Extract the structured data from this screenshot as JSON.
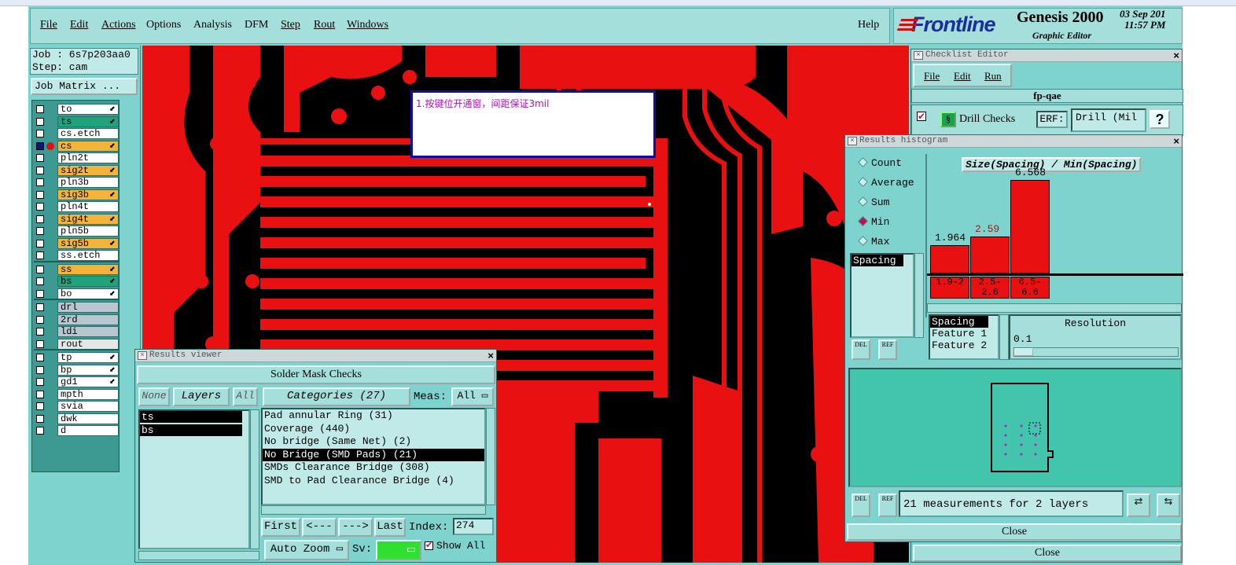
{
  "menu": {
    "items": [
      "File",
      "Edit",
      "Actions",
      "Options",
      "Analysis",
      "DFM",
      "Step",
      "Rout",
      "Windows"
    ],
    "help": "Help"
  },
  "brand": {
    "logo": "Frontline",
    "product": "Genesis 2000",
    "subtitle": "Graphic Editor",
    "date": "03 Sep 201",
    "time": "11:57 PM"
  },
  "job": {
    "job_label": "Job : 6s7p203aa0",
    "step_label": "Step: cam",
    "matrix_button": "Job Matrix ..."
  },
  "layers": [
    {
      "name": "to",
      "color": "#ffffff",
      "arrow": true
    },
    {
      "name": "ts",
      "color": "#1fa37a",
      "arrow": true
    },
    {
      "name": "cs.etch",
      "color": "#ffffff",
      "arrow": false
    },
    {
      "name": "cs",
      "color": "#f4b43c",
      "arrow": true,
      "active": true
    },
    {
      "name": "pln2t",
      "color": "#ffffff",
      "arrow": false
    },
    {
      "name": "sig2t",
      "color": "#f4b43c",
      "arrow": true
    },
    {
      "name": "pln3b",
      "color": "#ffffff",
      "arrow": false
    },
    {
      "name": "sig3b",
      "color": "#f4b43c",
      "arrow": true
    },
    {
      "name": "pln4t",
      "color": "#ffffff",
      "arrow": false
    },
    {
      "name": "sig4t",
      "color": "#f4b43c",
      "arrow": true
    },
    {
      "name": "pln5b",
      "color": "#ffffff",
      "arrow": false
    },
    {
      "name": "sig5b",
      "color": "#f4b43c",
      "arrow": true
    },
    {
      "name": "ss.etch",
      "color": "#ffffff",
      "arrow": false
    },
    {
      "name": "ss",
      "color": "#f4b43c",
      "arrow": true
    },
    {
      "name": "bs",
      "color": "#1fa37a",
      "arrow": true
    },
    {
      "name": "bo",
      "color": "#ffffff",
      "arrow": true
    },
    {
      "name": "drl",
      "color": "#b7c6cf",
      "arrow": false
    },
    {
      "name": "2rd",
      "color": "#b7c6cf",
      "arrow": false
    },
    {
      "name": "ldi",
      "color": "#b7c6cf",
      "arrow": false
    },
    {
      "name": "rout",
      "color": "#e6e6e6",
      "arrow": false
    },
    {
      "name": "tp",
      "color": "#ffffff",
      "arrow": true
    },
    {
      "name": "bp",
      "color": "#ffffff",
      "arrow": true
    },
    {
      "name": "gd1",
      "color": "#ffffff",
      "arrow": true
    },
    {
      "name": "mpth",
      "color": "#ffffff",
      "arrow": false
    },
    {
      "name": "svia",
      "color": "#ffffff",
      "arrow": false
    },
    {
      "name": "dwk",
      "color": "#ffffff",
      "arrow": false
    },
    {
      "name": "d",
      "color": "#ffffff",
      "arrow": false
    }
  ],
  "note": {
    "text": "1.按键位开通窗，间距保证3mil"
  },
  "results_viewer": {
    "title": "Results viewer",
    "header": "Solder Mask Checks",
    "none_btn": "None",
    "layers_btn": "Layers",
    "all_btn": "All",
    "categories_btn": "Categories (27)",
    "meas_label": "Meas:",
    "meas_value": "All",
    "layer_list": [
      "ts",
      "bs"
    ],
    "categories": [
      "Pad annular Ring (31)",
      "Coverage (440)",
      "No bridge (Same Net) (2)",
      "No Bridge (SMD Pads) (21)",
      "SMDs Clearance Bridge (308)",
      "SMD to Pad Clearance Bridge (4)"
    ],
    "selected_category": 3,
    "nav": {
      "first": "First",
      "prev": "<---",
      "next": "--->",
      "last": "Last",
      "index_label": "Index:",
      "index_value": "274"
    },
    "auto_zoom": "Auto Zoom",
    "sv_label": "Sv:",
    "show_all": "Show All"
  },
  "checklist": {
    "title": "Checklist Editor",
    "menu": [
      "File",
      "Edit",
      "Run"
    ],
    "name": "fp-qae",
    "check_label": "Drill Checks",
    "erf_label": "ERF:",
    "erf_value": "Drill (Mil",
    "help": "?",
    "close": "Close"
  },
  "histogram": {
    "title": "Results histogram",
    "modes": [
      "Count",
      "Average",
      "Sum",
      "Min",
      "Max"
    ],
    "selected_mode": "Min",
    "list_item": "Spacing",
    "chart_title": "Size(Spacing) / Min(Spacing)",
    "attributes": [
      "Spacing",
      "Feature 1",
      "Feature 2"
    ],
    "resolution_label": "Resolution",
    "resolution_value": "0.1",
    "del": "DEL",
    "ref": "REF",
    "summary": "21 measurements for 2 layers",
    "close": "Close"
  },
  "chart_data": {
    "type": "bar",
    "title": "Size(Spacing) / Min(Spacing)",
    "categories": [
      "1.9-2",
      "2.5-2.6",
      "6.5-6.6"
    ],
    "values": [
      1.964,
      2.59,
      6.568
    ],
    "value_labels": [
      "1.964",
      "2.59",
      "6.568"
    ],
    "ylim": [
      0,
      7.5
    ]
  },
  "colors": {
    "accent": "#7fd3cf",
    "copper": "#e81010",
    "background": "#000000"
  }
}
